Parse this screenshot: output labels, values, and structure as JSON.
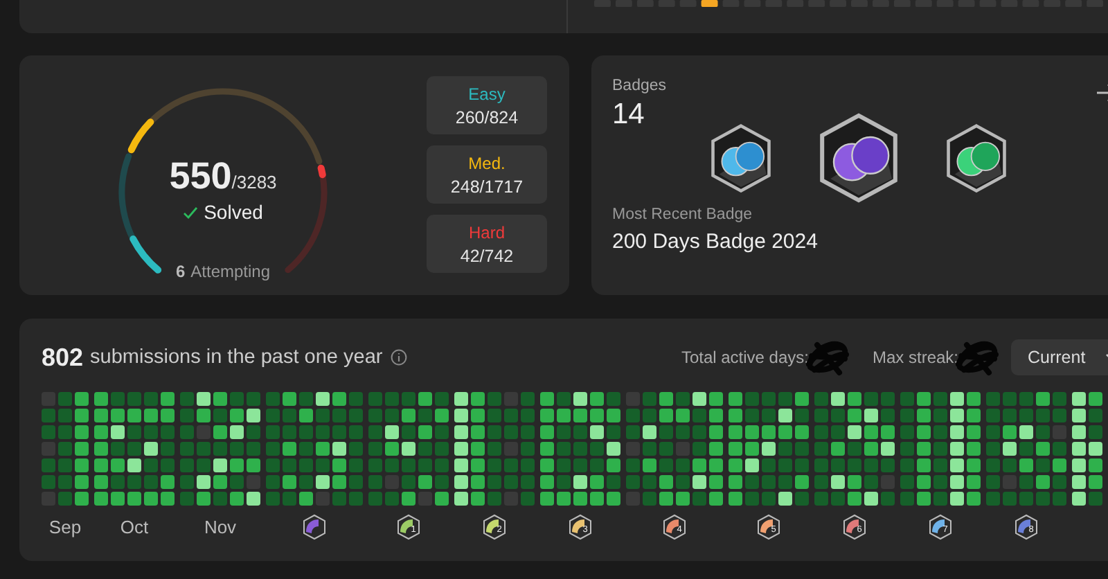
{
  "progress": {
    "solved": "550",
    "total": "/3283",
    "solved_label": "Solved",
    "attempting_count": "6",
    "attempting_label": "Attempting",
    "gauge": [
      {
        "kind": "easy",
        "level": 0.32
      },
      {
        "kind": "medium",
        "level": 0.14
      },
      {
        "kind": "hard",
        "level": 0.06
      }
    ],
    "difficulties": [
      {
        "kind": "easy",
        "label": "Easy",
        "count": "260/824"
      },
      {
        "kind": "medium",
        "label": "Med.",
        "count": "248/1717"
      },
      {
        "kind": "hard",
        "label": "Hard",
        "count": "42/742"
      }
    ]
  },
  "badges": {
    "title": "Badges",
    "count": "14",
    "items": [
      {
        "kind": "hundred"
      },
      {
        "kind": "two-hundred"
      },
      {
        "kind": "fifty"
      }
    ],
    "recent_label": "Most Recent Badge",
    "recent_name": "200 Days Badge 2024"
  },
  "submissions": {
    "count": "802",
    "text": "submissions in the past one year",
    "active_days_label": "Total active days:",
    "max_streak_label": "Max streak:",
    "dropdown": "Current",
    "months": [
      {
        "kind": "text",
        "label": "Sep"
      },
      {
        "kind": "text",
        "label": "Oct"
      },
      {
        "kind": "text",
        "label": "Nov"
      },
      {
        "kind": "badge",
        "color": "#8a5cd6"
      },
      {
        "kind": "badge",
        "color": "#9ccc65",
        "label": "1"
      },
      {
        "kind": "badge",
        "color": "#c5d86d",
        "label": "2"
      },
      {
        "kind": "badge",
        "color": "#e8c170",
        "label": "3"
      },
      {
        "kind": "badge",
        "color": "#e88a6a",
        "label": "4"
      },
      {
        "kind": "badge",
        "color": "#f0a070",
        "label": "5"
      },
      {
        "kind": "badge",
        "color": "#e07a7a",
        "label": "6"
      },
      {
        "kind": "badge",
        "color": "#6fb2e8",
        "label": "7"
      },
      {
        "kind": "badge",
        "color": "#6a7fd8",
        "label": "8"
      },
      {
        "kind": "none"
      }
    ]
  }
}
